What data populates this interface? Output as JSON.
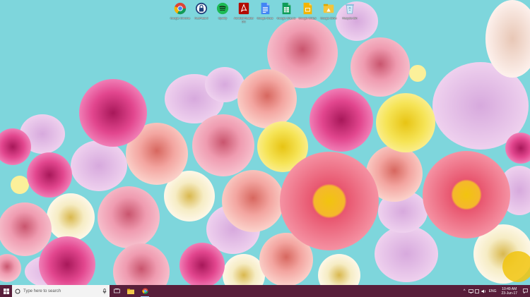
{
  "desktop": {
    "icons": [
      {
        "label": "Google Chrome",
        "icon": "chrome-icon",
        "color": "#4285f4"
      },
      {
        "label": "KeePass 2",
        "icon": "keepass-lock-icon",
        "color": "#2b5da8"
      },
      {
        "label": "Spotify",
        "icon": "spotify-icon",
        "color": "#1db954"
      },
      {
        "label": "Acrobat Reader DC",
        "icon": "acrobat-icon",
        "color": "#b30b00"
      },
      {
        "label": "Google Docs",
        "icon": "docs-icon",
        "color": "#4285f4"
      },
      {
        "label": "Google Sheets",
        "icon": "sheets-icon",
        "color": "#0f9d58"
      },
      {
        "label": "Google Slides",
        "icon": "slides-icon",
        "color": "#f4b400"
      },
      {
        "label": "Google Drive",
        "icon": "drive-icon",
        "color": "#f4b400"
      },
      {
        "label": "Recycle Bin",
        "icon": "recycle-bin-icon",
        "color": "#9fd4f0"
      }
    ]
  },
  "taskbar": {
    "search_placeholder": "Type here to search",
    "language": "ENG",
    "time": "10:49 AM",
    "date": "23-Jun-17",
    "color": "#581e3a"
  },
  "wallpaper": {
    "background_color": "#7ed6dc"
  }
}
